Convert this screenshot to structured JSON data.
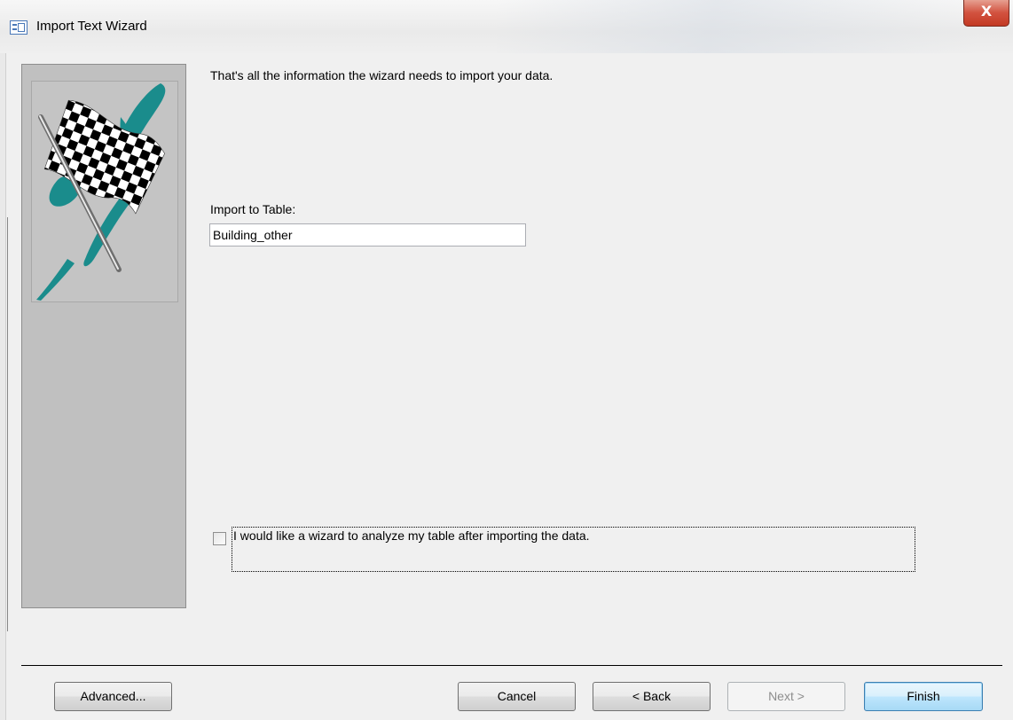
{
  "window": {
    "title": "Import Text Wizard",
    "close_label": "X"
  },
  "icons": {
    "app": "table-icon",
    "close": "close-icon",
    "flag": "checkered-flag-icon"
  },
  "main": {
    "message": "That's all the information the wizard needs to import your data.",
    "import_label": "Import to Table:",
    "import_value": "Building_other",
    "analyze_checked": false,
    "analyze_label": "I would like a wizard to analyze my table after importing the data."
  },
  "buttons": {
    "advanced": "Advanced...",
    "cancel": "Cancel",
    "back": "< Back",
    "next": "Next >",
    "finish": "Finish"
  },
  "colors": {
    "panel": "#c0c0c0",
    "teal": "#1a8c8c",
    "close_button": "#c33a24"
  }
}
